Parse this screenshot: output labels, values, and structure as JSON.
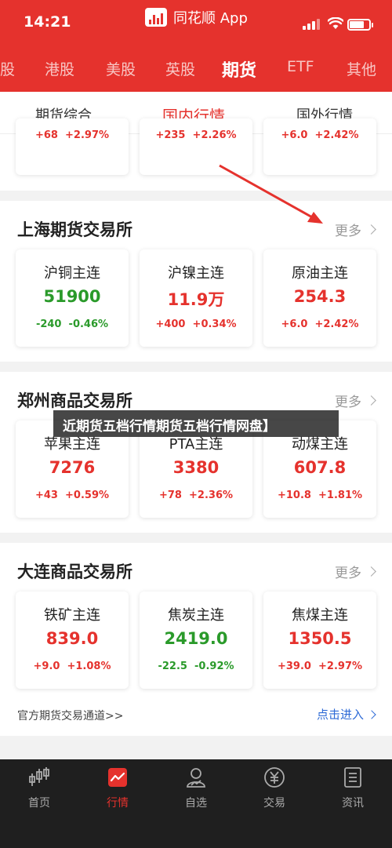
{
  "status_bar": {
    "time": "14:21"
  },
  "app": {
    "name": "同花顺 App"
  },
  "market_tabs": [
    {
      "label": "股",
      "active": false
    },
    {
      "label": "港股",
      "active": false
    },
    {
      "label": "美股",
      "active": false
    },
    {
      "label": "英股",
      "active": false
    },
    {
      "label": "期货",
      "active": true
    },
    {
      "label": "ETF",
      "active": false
    },
    {
      "label": "其他",
      "active": false
    }
  ],
  "sub_tabs": [
    {
      "label": "期货综合",
      "active": false
    },
    {
      "label": "国内行情",
      "active": true
    },
    {
      "label": "国外行情",
      "active": false
    }
  ],
  "top_partial_cards": [
    {
      "change": "+68",
      "pct": "+2.97%",
      "dir": "up"
    },
    {
      "change": "+235",
      "pct": "+2.26%",
      "dir": "up"
    },
    {
      "change": "+6.0",
      "pct": "+2.42%",
      "dir": "up"
    }
  ],
  "exchanges": [
    {
      "title": "上海期货交易所",
      "more": "更多",
      "cards": [
        {
          "name": "沪铜主连",
          "price": "51900",
          "change": "-240",
          "pct": "-0.46%",
          "dir": "down"
        },
        {
          "name": "沪镍主连",
          "price": "11.9万",
          "change": "+400",
          "pct": "+0.34%",
          "dir": "up"
        },
        {
          "name": "原油主连",
          "price": "254.3",
          "change": "+6.0",
          "pct": "+2.42%",
          "dir": "up"
        }
      ]
    },
    {
      "title": "郑州商品交易所",
      "more": "更多",
      "cards": [
        {
          "name": "苹果主连",
          "price": "7276",
          "change": "+43",
          "pct": "+0.59%",
          "dir": "up"
        },
        {
          "name": "PTA主连",
          "price": "3380",
          "change": "+78",
          "pct": "+2.36%",
          "dir": "up"
        },
        {
          "name": "动煤主连",
          "price": "607.8",
          "change": "+10.8",
          "pct": "+1.81%",
          "dir": "up"
        }
      ]
    },
    {
      "title": "大连商品交易所",
      "more": "更多",
      "cards": [
        {
          "name": "铁矿主连",
          "price": "839.0",
          "change": "+9.0",
          "pct": "+1.08%",
          "dir": "up"
        },
        {
          "name": "焦炭主连",
          "price": "2419.0",
          "change": "-22.5",
          "pct": "-0.92%",
          "dir": "down"
        },
        {
          "name": "焦煤主连",
          "price": "1350.5",
          "change": "+39.0",
          "pct": "+2.97%",
          "dir": "up"
        }
      ]
    }
  ],
  "watermark": "近期货五档行情期货五档行情网盘】",
  "footer": {
    "link": "官方期货交易通道>>",
    "enter": "点击进入"
  },
  "bottom_nav": [
    {
      "label": "首页",
      "icon": "candlestick-icon",
      "active": false
    },
    {
      "label": "行情",
      "icon": "chart-icon",
      "active": true
    },
    {
      "label": "自选",
      "icon": "person-icon",
      "active": false
    },
    {
      "label": "交易",
      "icon": "yen-icon",
      "active": false
    },
    {
      "label": "资讯",
      "icon": "news-icon",
      "active": false
    }
  ],
  "colors": {
    "brand_red": "#e5322d",
    "down_green": "#2a9a2a",
    "link_blue": "#2d6ad6"
  }
}
